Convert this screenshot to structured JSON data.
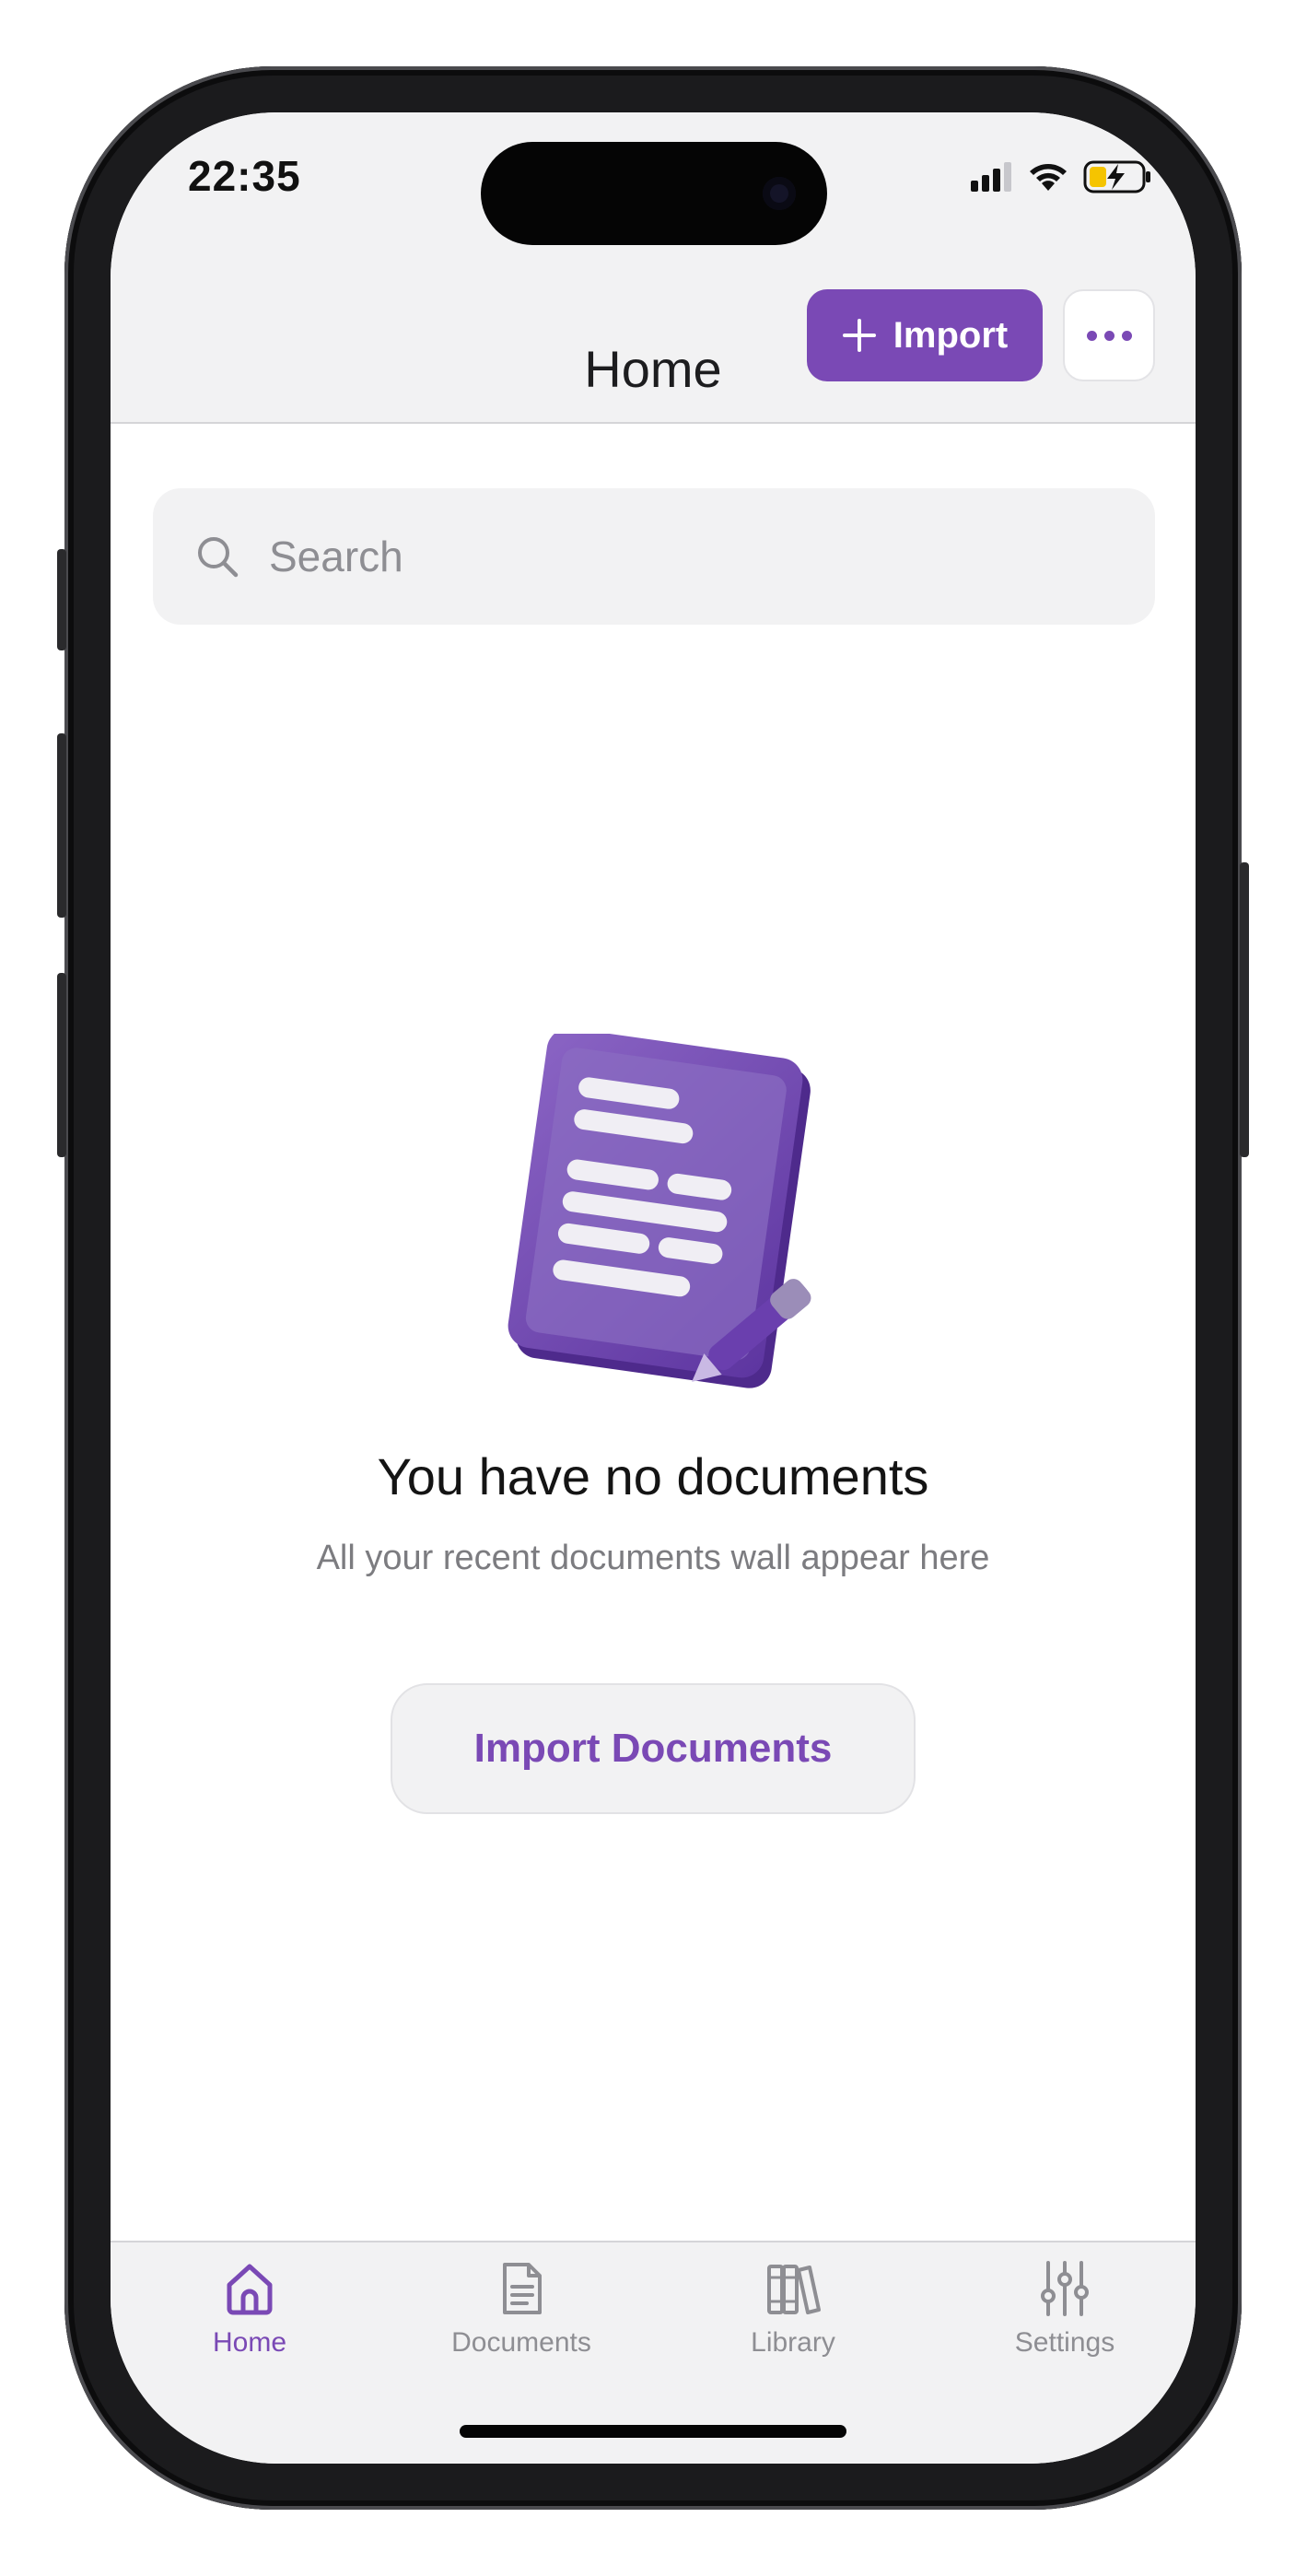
{
  "status_bar": {
    "time": "22:35"
  },
  "header": {
    "title": "Home",
    "import_label": "Import"
  },
  "search": {
    "placeholder": "Search"
  },
  "empty_state": {
    "title": "You have no documents",
    "subtitle": "All your recent documents wall appear here",
    "button_label": "Import Documents"
  },
  "tabs": [
    {
      "label": "Home",
      "icon": "home-icon",
      "active": true
    },
    {
      "label": "Documents",
      "icon": "document-icon",
      "active": false
    },
    {
      "label": "Library",
      "icon": "library-icon",
      "active": false
    },
    {
      "label": "Settings",
      "icon": "sliders-icon",
      "active": false
    }
  ],
  "colors": {
    "accent": "#7a49b5",
    "bar_background": "#f2f2f3",
    "inactive": "#8e8e93"
  }
}
